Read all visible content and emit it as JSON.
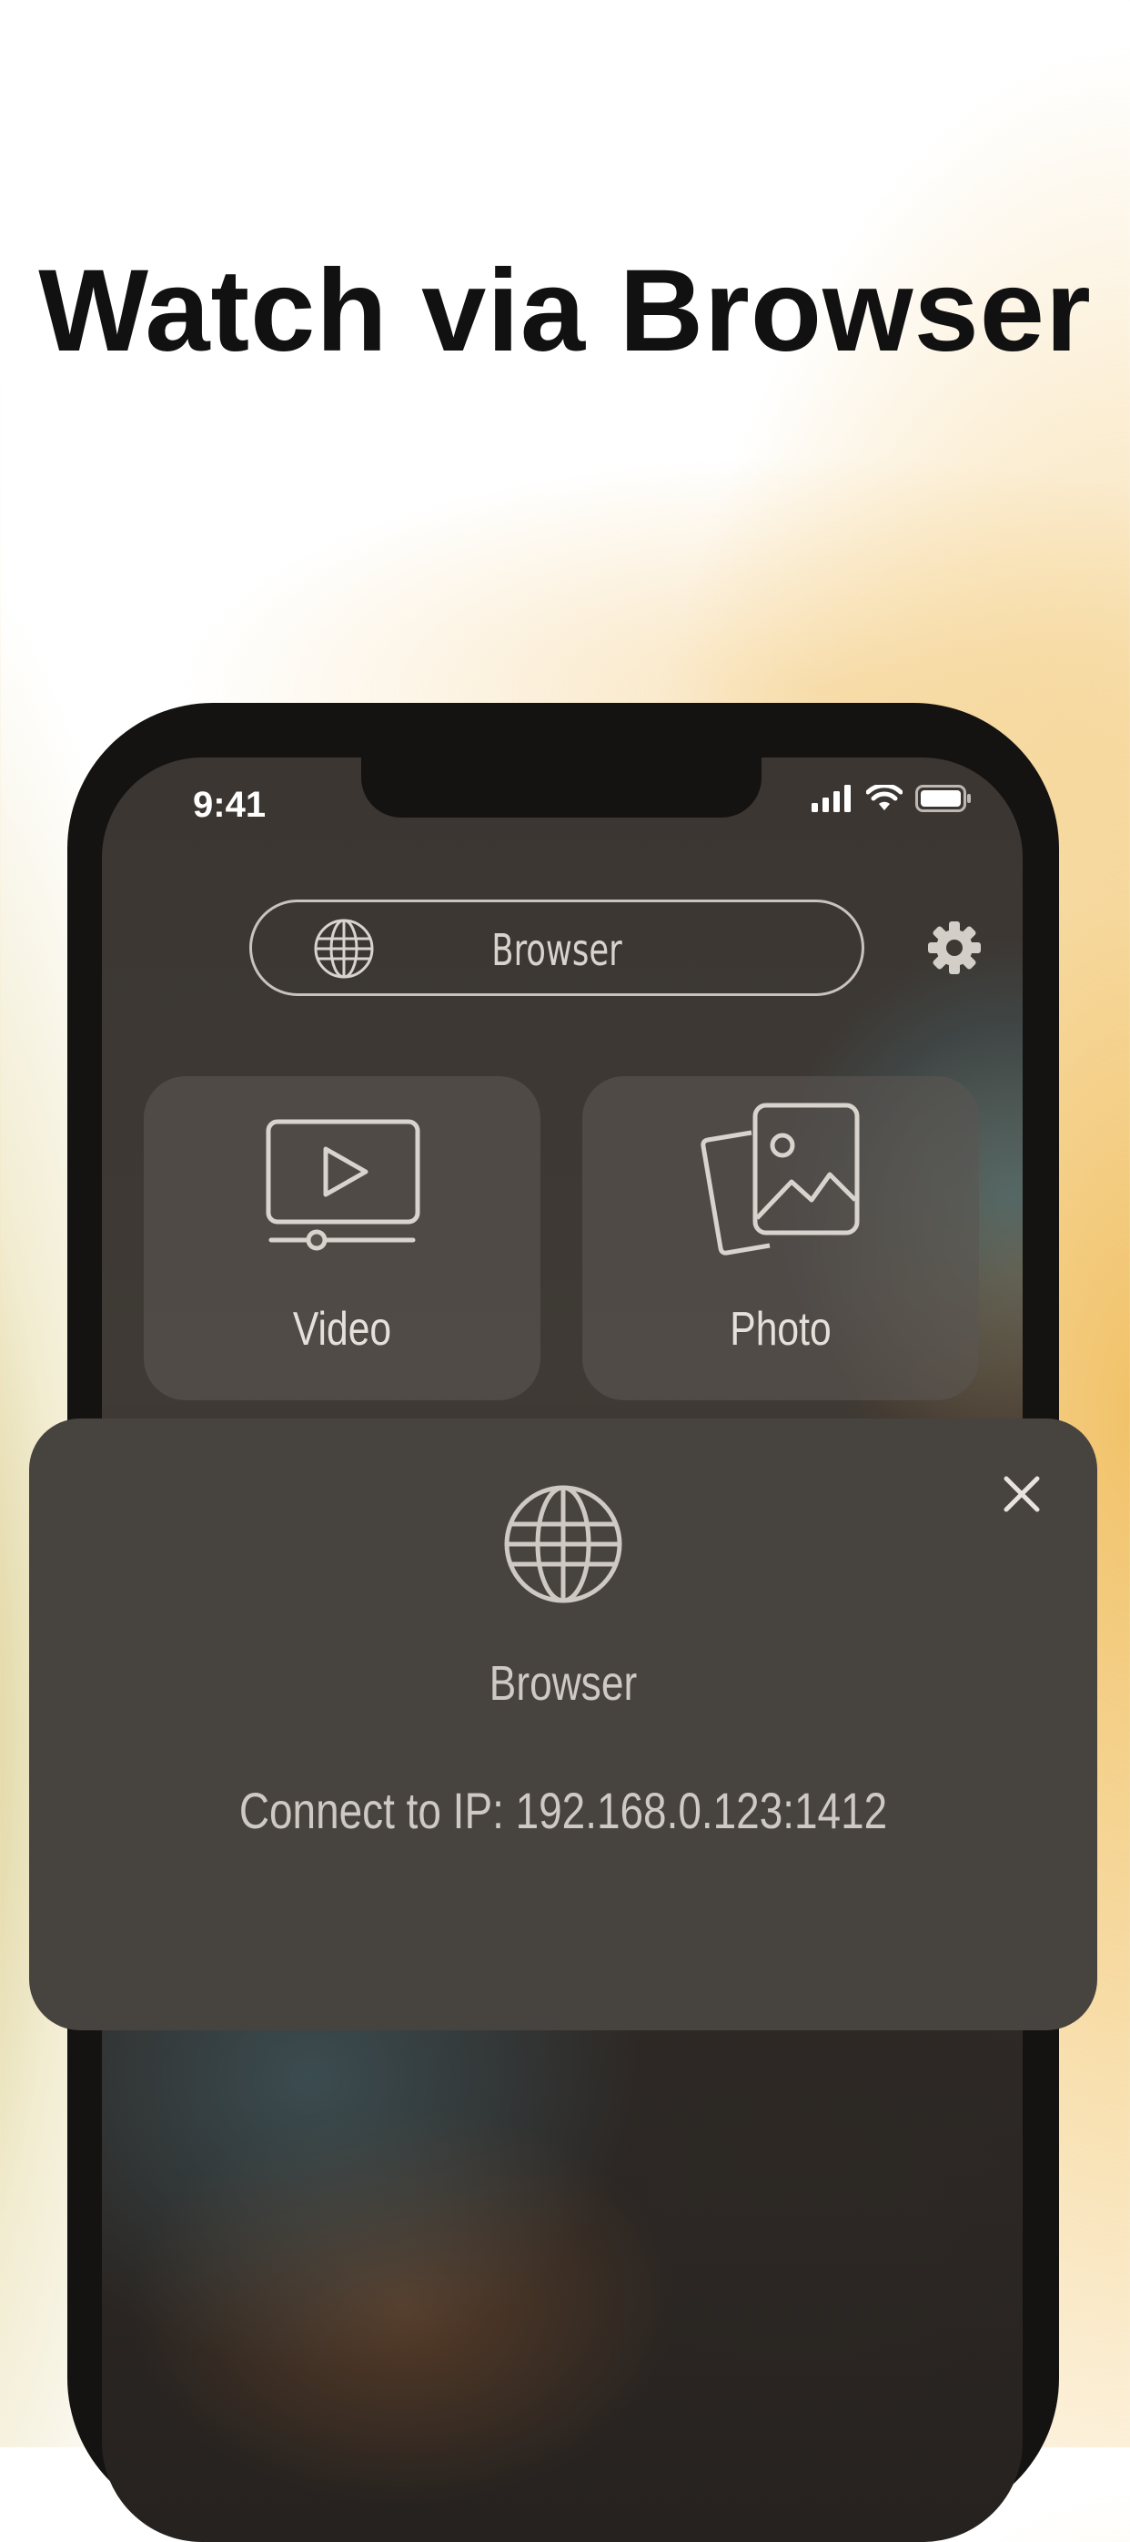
{
  "headline": "Watch via Browser",
  "status_bar": {
    "time": "9:41",
    "icons": [
      "signal-icon",
      "wifi-icon",
      "battery-icon"
    ]
  },
  "top_bar": {
    "browser_button_label": "Browser",
    "browser_icon": "globe-icon",
    "settings_icon": "gear-icon"
  },
  "tiles": [
    {
      "label": "Video",
      "icon": "video-player-icon"
    },
    {
      "label": "Photo",
      "icon": "photo-stack-icon"
    }
  ],
  "modal": {
    "icon": "globe-icon",
    "title": "Browser",
    "message": "Connect to IP: 192.168.0.123:1412",
    "close_icon": "close-icon"
  },
  "colors": {
    "headline": "#111111",
    "phone_frame": "#141312",
    "modal_background": "#47433f",
    "ui_text": "#d8d3cd",
    "accent_warm": "#f0be5f"
  }
}
